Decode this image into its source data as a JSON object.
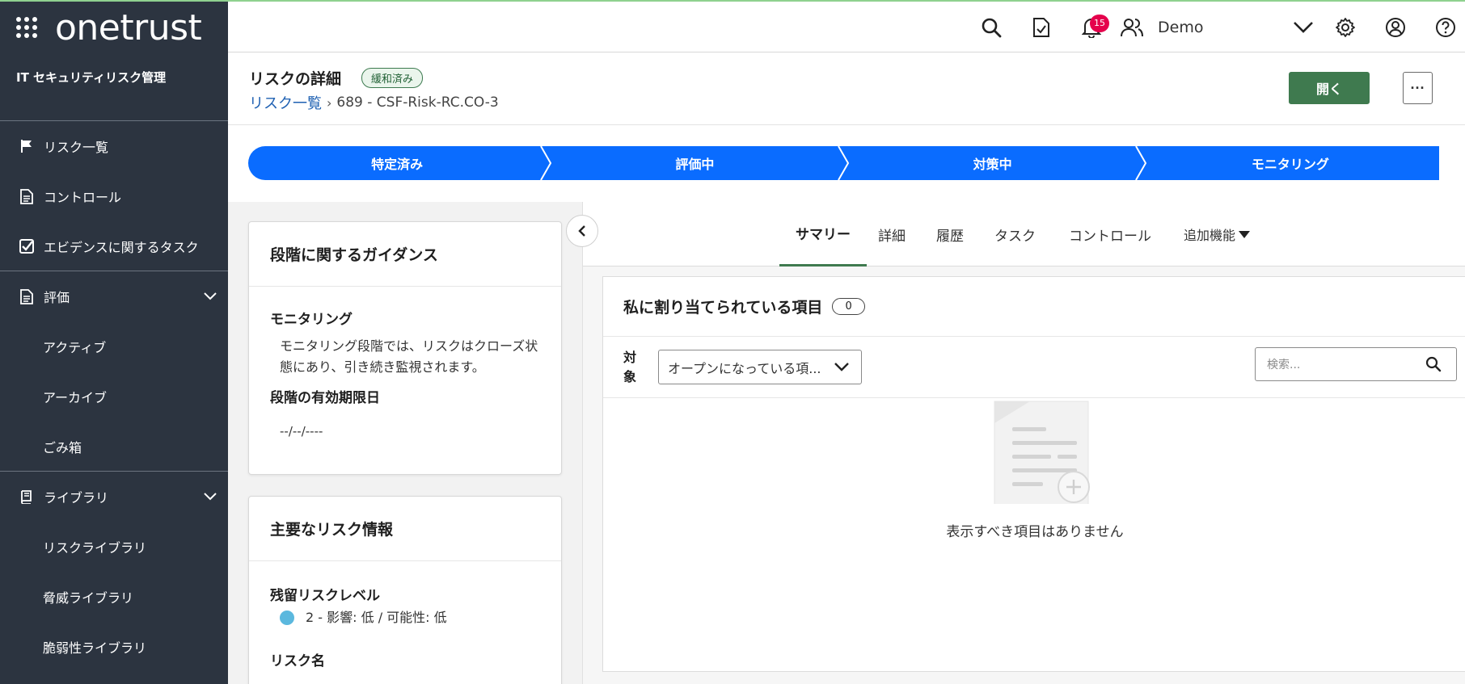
{
  "brand": {
    "name": "onetrust",
    "icon": "grid-icon"
  },
  "sidebar": {
    "module_title": "IT セキュリティリスク管理",
    "items": [
      {
        "label": "リスク一覧",
        "icon": "flag-icon"
      },
      {
        "label": "コントロール",
        "icon": "document-icon"
      },
      {
        "label": "エビデンスに関するタスク",
        "icon": "checkbox-icon"
      },
      {
        "label": "評価",
        "icon": "document-icon"
      },
      {
        "label": "アクティブ"
      },
      {
        "label": "アーカイブ"
      },
      {
        "label": "ごみ箱"
      },
      {
        "label": "ライブラリ",
        "icon": "book-icon"
      },
      {
        "label": "リスクライブラリ"
      },
      {
        "label": "脅威ライブラリ"
      },
      {
        "label": "脆弱性ライブラリ"
      }
    ]
  },
  "topbar": {
    "notification_count": "15",
    "user_name": "Demo"
  },
  "header": {
    "title": "リスクの詳細",
    "status": "緩和済み",
    "breadcrumb_link": "リスク一覧",
    "breadcrumb_current": "689 - CSF-Risk-RC.CO-3",
    "open_button": "開く",
    "more_button": "···"
  },
  "stages": [
    "特定済み",
    "評価中",
    "対策中",
    "モニタリング"
  ],
  "guidance": {
    "title": "段階に関するガイダンス",
    "stage_name": "モニタリング",
    "stage_desc": "モニタリング段階では、リスクはクローズ状態にあり、引き続き監視されます。",
    "deadline_label": "段階の有効期限日",
    "deadline_value": "--/--/----"
  },
  "risk_info": {
    "title": "主要なリスク情報",
    "residual_label": "残留リスクレベル",
    "residual_value": "2 - 影響: 低 / 可能性: 低",
    "residual_color": "#5bb8de",
    "risk_name_label": "リスク名"
  },
  "tabs": [
    "サマリー",
    "詳細",
    "履歴",
    "タスク",
    "コントロール",
    "追加機能"
  ],
  "assigned": {
    "title": "私に割り当てられている項目",
    "count": "0",
    "filter_label": "対象",
    "filter_value": "オープンになっている項...",
    "search_placeholder": "検索...",
    "empty_text": "表示すべき項目はありません"
  }
}
